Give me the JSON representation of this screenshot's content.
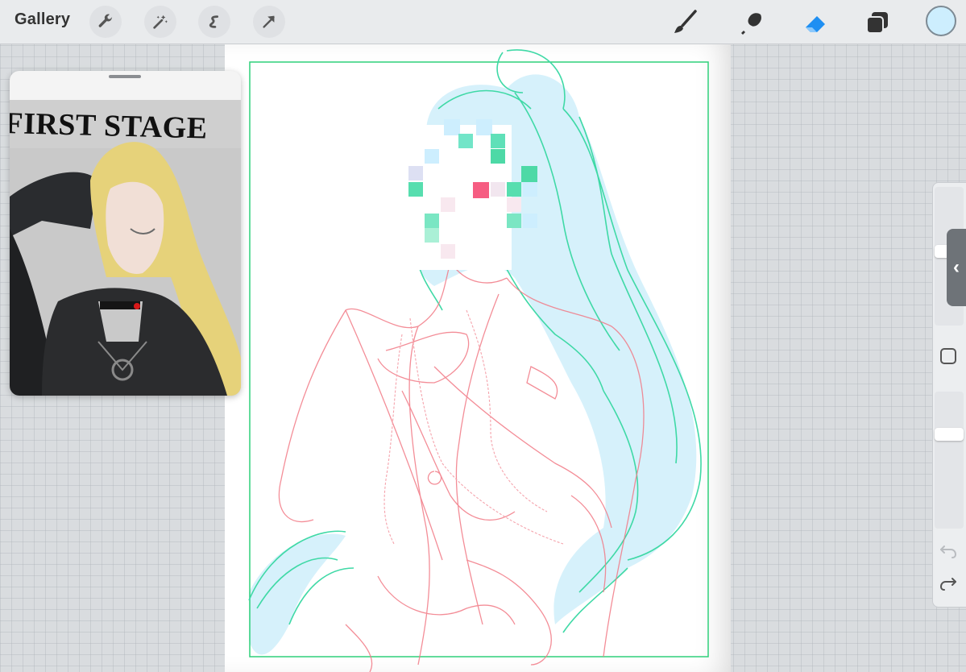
{
  "toolbar": {
    "gallery_label": "Gallery",
    "left_tools": [
      "wrench-icon",
      "magic-wand-icon",
      "selection-icon",
      "transform-arrow-icon"
    ],
    "right_tools": [
      "brush-icon",
      "smudge-icon",
      "eraser-icon",
      "layers-icon"
    ],
    "active_tool": "eraser-icon",
    "current_color": "#cdeefe",
    "accent_color": "#1f8ff2"
  },
  "reference_window": {
    "title_text": "FIRST STAGE"
  },
  "canvas": {
    "background": "#ffffff",
    "frame_color": "#2fd07a",
    "sketch_colors": [
      "#f27a86",
      "#3fd9a6",
      "#d6f1fb"
    ],
    "face_censored": true
  },
  "sidebar": {
    "brush_size_level": 0.97,
    "opacity_level": 0.26,
    "collapse_icon": "chevron-left-icon",
    "modify_icon": "square-icon",
    "undo_icon": "undo-icon",
    "redo_icon": "redo-icon"
  }
}
